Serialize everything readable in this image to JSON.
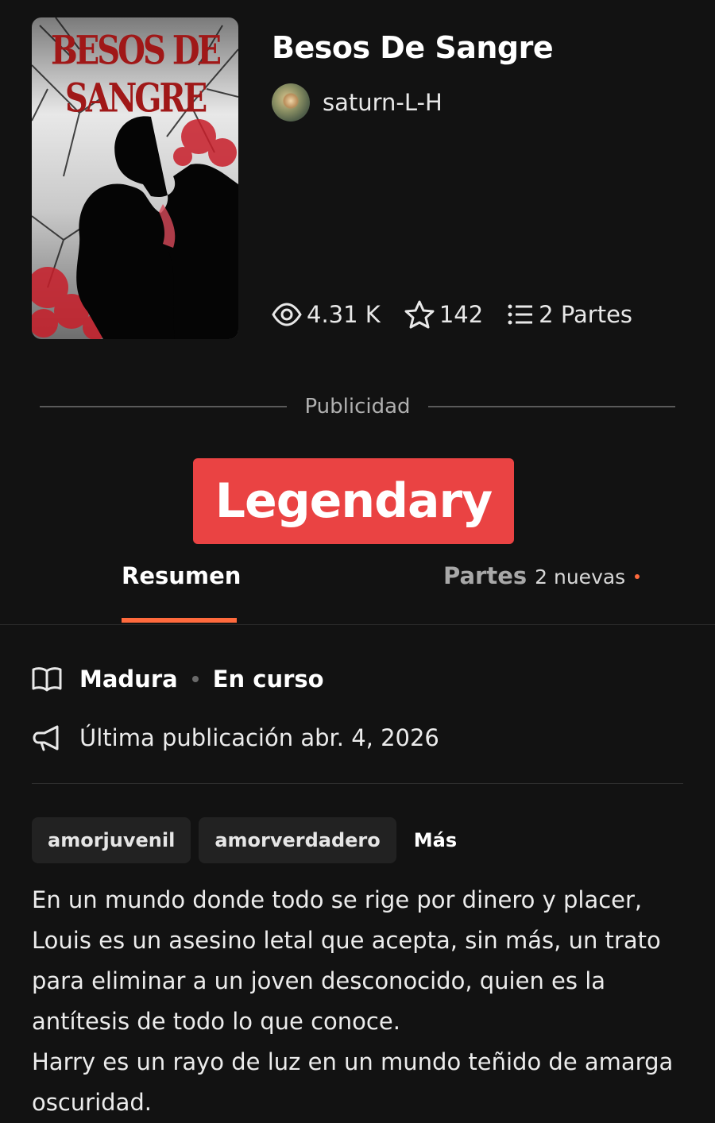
{
  "story": {
    "title": "Besos De Sangre",
    "cover_title_line1": "BESOS DE",
    "cover_title_line2": "SANGRE",
    "author": "saturn-L-H",
    "stats": {
      "reads": "4.31 K",
      "votes": "142",
      "parts": "2 Partes"
    }
  },
  "ad": {
    "label": "Publicidad",
    "banner_text": "Legendary",
    "banner_color": "#ea4343"
  },
  "tabs": {
    "summary": "Resumen",
    "parts": "Partes",
    "parts_new": "2 nuevas",
    "accent_color": "#ff6a3d"
  },
  "meta": {
    "rating": "Madura",
    "status": "En curso",
    "last_update": "Última publicación abr. 4, 2026"
  },
  "tags": [
    "amorjuvenil",
    "amorverdadero"
  ],
  "tags_more": "Más",
  "description": [
    "En un mundo donde todo se rige por dinero y placer,",
    "Louis es un asesino letal que acepta, sin más, un trato",
    "para eliminar a un joven desconocido, quien es la",
    "antítesis de todo lo que conoce.",
    "Harry es un rayo de luz en un mundo teñido de amarga",
    "oscuridad."
  ],
  "icons": {
    "reads": "eye-icon",
    "votes": "star-icon",
    "parts": "list-icon",
    "rating": "book-icon",
    "update": "megaphone-icon"
  }
}
